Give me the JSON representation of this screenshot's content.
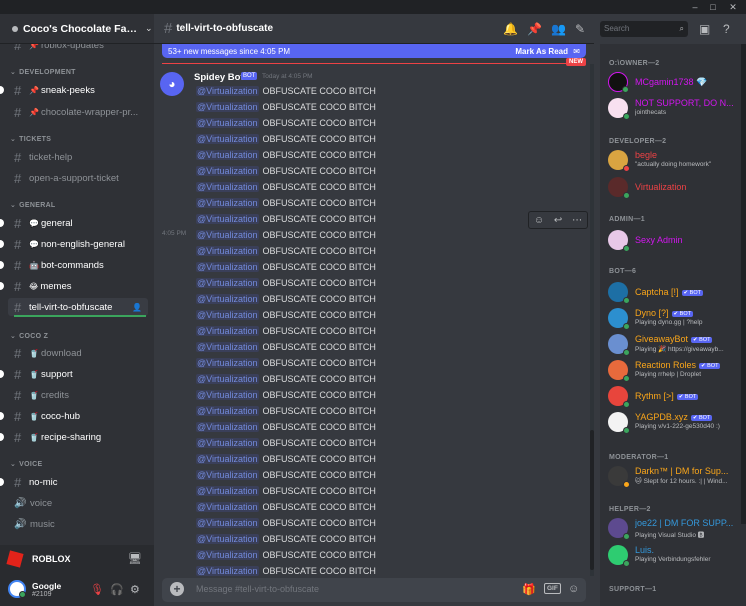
{
  "window": {
    "controls": [
      "–",
      "□",
      "✕"
    ]
  },
  "server": {
    "name": "Coco's Chocolate Fact..."
  },
  "sidebar": {
    "channels": [
      {
        "id": "roblox-updates",
        "label": "roblox-updates",
        "emoji": "",
        "top": 0
      },
      {
        "id": "sneak-peeks",
        "label": "sneak-peeks",
        "emoji": "📌"
      },
      {
        "id": "chocolate-wrapper-pr",
        "label": "chocolate-wrapper-pr...",
        "emoji": "📌"
      },
      {
        "id": "ticket-help",
        "label": "ticket-help"
      },
      {
        "id": "open-a-support-ticket",
        "label": "open-a-support-ticket"
      },
      {
        "id": "general",
        "label": "general",
        "emoji": "💬"
      },
      {
        "id": "non-english-general",
        "label": "non-english-general",
        "emoji": "💬"
      },
      {
        "id": "bot-commands",
        "label": "bot-commands",
        "emoji": "🤖"
      },
      {
        "id": "memes",
        "label": "memes",
        "emoji": "😂"
      },
      {
        "id": "tell-virt-to-obfuscate",
        "label": "tell-virt-to-obfuscate"
      },
      {
        "id": "download",
        "label": "download",
        "emoji": "🥤"
      },
      {
        "id": "support",
        "label": "support",
        "emoji": "🥤"
      },
      {
        "id": "credits",
        "label": "credits",
        "emoji": "🥤"
      },
      {
        "id": "coco-hub",
        "label": "coco-hub",
        "emoji": "🥤"
      },
      {
        "id": "recipe-sharing",
        "label": "recipe-sharing",
        "emoji": "🥤"
      },
      {
        "id": "no-mic",
        "label": "no-mic"
      },
      {
        "id": "voice",
        "label": "voice"
      },
      {
        "id": "music",
        "label": "music"
      }
    ],
    "categories": {
      "development": "DEVELOPMENT",
      "tickets": "TICKETS",
      "general": "GENERAL",
      "cocoz": "COCO Z",
      "voice": "VOICE"
    }
  },
  "activity": {
    "game": "ROBLOX"
  },
  "user": {
    "name": "Google",
    "tag": "#2109"
  },
  "channel_header": {
    "title": "tell-virt-to-obfuscate"
  },
  "search": {
    "placeholder": "Search"
  },
  "new_messages": {
    "text": "53+ new messages since 4:05 PM",
    "mark_as_read": "Mark As Read",
    "pill": "NEW"
  },
  "message": {
    "author": "Spidey Bot",
    "badge": "BOT",
    "timestamp": "Today at 4:05 PM",
    "hover_time": "4:05 PM",
    "mention": "@Virtualization",
    "body": "OBFUSCATE COCO BITCH",
    "line_count": 32
  },
  "composer": {
    "placeholder": "Message #tell-virt-to-obfuscate",
    "gif": "GIF"
  },
  "members": {
    "groups": [
      {
        "id": "owner",
        "label": "O:\\OWNER—2"
      },
      {
        "id": "developer",
        "label": "DEVELOPER—2"
      },
      {
        "id": "admin",
        "label": "ADMIN—1"
      },
      {
        "id": "bot",
        "label": "BOT—6"
      },
      {
        "id": "moderator",
        "label": "MODERATOR—1"
      },
      {
        "id": "helper",
        "label": "HELPER—2"
      },
      {
        "id": "support",
        "label": "SUPPORT—1"
      }
    ],
    "list": [
      {
        "name": "MCgamin1738",
        "sub": "",
        "color": "#d216ef",
        "extra": "💎"
      },
      {
        "name": "NOT SUPPORT, DO N...",
        "sub": "jointhecats",
        "color": "#d216ef"
      },
      {
        "name": "begle",
        "sub": "\"actually doing homework\"",
        "color": "#ed4245"
      },
      {
        "name": "Virtualization",
        "sub": "",
        "color": "#ed4245"
      },
      {
        "name": "Sexy Admin",
        "sub": "",
        "color": "#d216ef"
      },
      {
        "name": "Captcha [!]",
        "sub": "",
        "color": "#faa61a",
        "bot": "✔ BOT"
      },
      {
        "name": "Dyno [?]",
        "sub": "Playing dyno.gg | ?help",
        "color": "#faa61a",
        "bot": "✔ BOT"
      },
      {
        "name": "GiveawayBot",
        "sub": "Playing 🎉 https://giveawayb...",
        "color": "#faa61a",
        "bot": "✔ BOT"
      },
      {
        "name": "Reaction Roles",
        "sub": "Playing rrhelp | Droplet",
        "color": "#faa61a",
        "bot": "✔ BOT"
      },
      {
        "name": "Rythm [>]",
        "sub": "",
        "color": "#faa61a",
        "bot": "✔ BOT"
      },
      {
        "name": "YAGPDB.xyz",
        "sub": "Playing v/v1-222-ge530d40 :)",
        "color": "#faa61a",
        "bot": "✔ BOT"
      },
      {
        "name": "Darkn™ | DM for Sup...",
        "sub": "🐱 Slept for 12 hours. :| | Wind...",
        "color": "#faa61a"
      },
      {
        "name": "joe22 | DM FOR SUPP...",
        "sub": "Playing Visual Studio 🅱",
        "color": "#3498db"
      },
      {
        "name": "Luis.",
        "sub": "Playing Verbindungsfehler",
        "color": "#3498db"
      }
    ]
  },
  "colors": {
    "accent": "#5865f2",
    "mention": "#7289da",
    "online": "#3ba55d",
    "new": "#ed4245"
  }
}
